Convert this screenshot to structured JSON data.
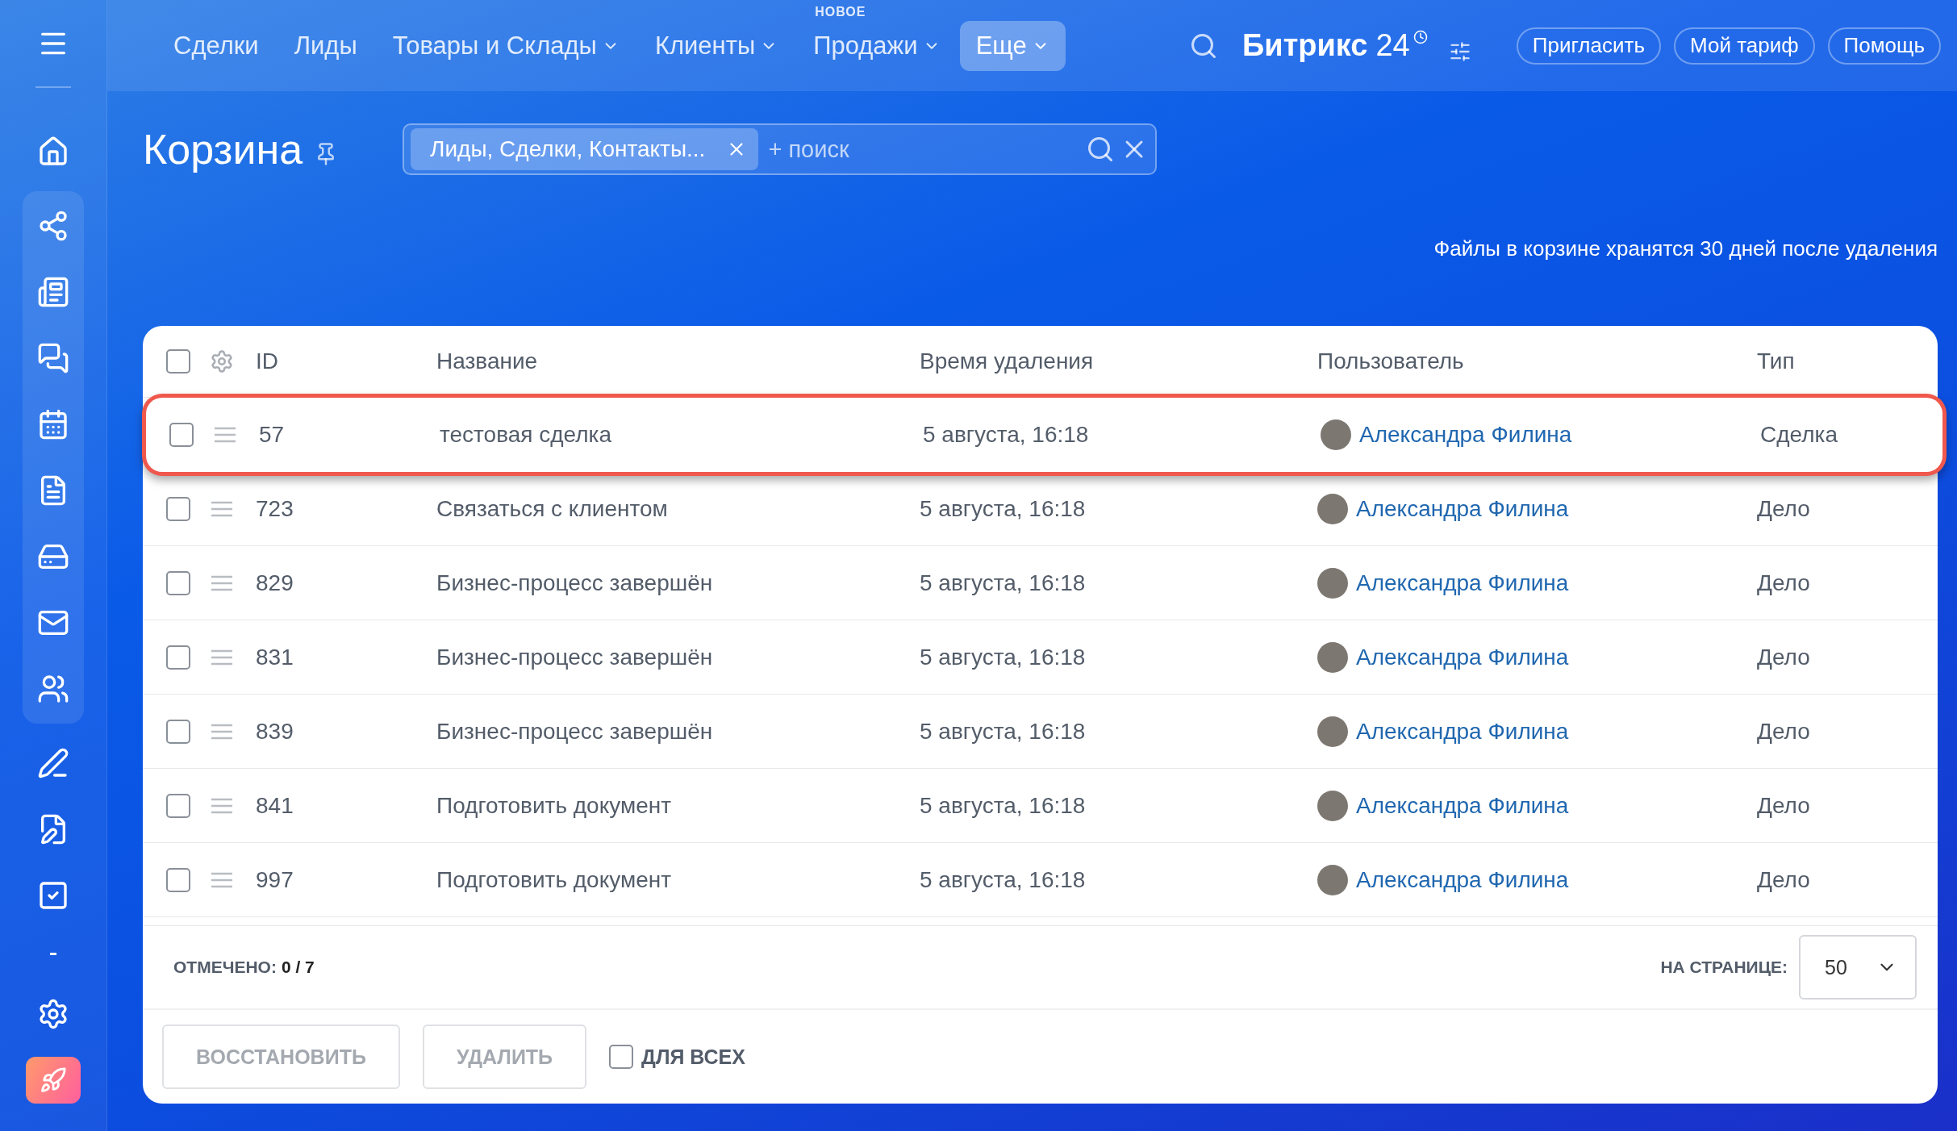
{
  "topbar": {
    "nav": [
      {
        "label": "Сделки",
        "dropdown": false,
        "selected": false
      },
      {
        "label": "Лиды",
        "dropdown": false,
        "selected": false
      },
      {
        "label": "Товары и Склады",
        "dropdown": true,
        "selected": false
      },
      {
        "label": "Клиенты",
        "dropdown": true,
        "selected": false
      },
      {
        "label": "Продажи",
        "dropdown": true,
        "selected": false,
        "badge": "НОВОЕ"
      },
      {
        "label": "Еще",
        "dropdown": true,
        "selected": true
      }
    ],
    "brand": {
      "name": "Битрикс",
      "number": "24"
    },
    "buttons": [
      "Пригласить",
      "Мой тариф",
      "Помощь"
    ]
  },
  "page": {
    "title": "Корзина",
    "filter": {
      "chip": "Лиды, Сделки, Контакты...",
      "placeholder": "+ поиск"
    },
    "note": "Файлы в корзине хранятся 30 дней после удаления"
  },
  "table": {
    "columns": [
      "ID",
      "Название",
      "Время удаления",
      "Пользователь",
      "Тип"
    ],
    "all_checked": false,
    "rows": [
      {
        "id": "57",
        "name": "тестовая сделка",
        "time": "5 августа, 16:18",
        "user": "Александра Филина",
        "type": "Сделка",
        "checked": false,
        "highlighted": true
      },
      {
        "id": "723",
        "name": "Связаться с клиентом",
        "time": "5 августа, 16:18",
        "user": "Александра Филина",
        "type": "Дело",
        "checked": false,
        "highlighted": false
      },
      {
        "id": "829",
        "name": "Бизнес-процесс завершён",
        "time": "5 августа, 16:18",
        "user": "Александра Филина",
        "type": "Дело",
        "checked": false,
        "highlighted": false
      },
      {
        "id": "831",
        "name": "Бизнес-процесс завершён",
        "time": "5 августа, 16:18",
        "user": "Александра Филина",
        "type": "Дело",
        "checked": false,
        "highlighted": false
      },
      {
        "id": "839",
        "name": "Бизнес-процесс завершён",
        "time": "5 августа, 16:18",
        "user": "Александра Филина",
        "type": "Дело",
        "checked": false,
        "highlighted": false
      },
      {
        "id": "841",
        "name": "Подготовить документ",
        "time": "5 августа, 16:18",
        "user": "Александра Филина",
        "type": "Дело",
        "checked": false,
        "highlighted": false
      },
      {
        "id": "997",
        "name": "Подготовить документ",
        "time": "5 августа, 16:18",
        "user": "Александра Филина",
        "type": "Дело",
        "checked": false,
        "highlighted": false
      }
    ]
  },
  "footer": {
    "selected_label": "ОТМЕЧЕНО:",
    "selected_count": "0 / 7",
    "per_page_label": "НА СТРАНИЦЕ:",
    "per_page": "50",
    "buttons": [
      {
        "label": "ВОССТАНОВИТЬ",
        "disabled": true
      },
      {
        "label": "УДАЛИТЬ",
        "disabled": true
      }
    ],
    "for_all": {
      "label": "ДЛЯ ВСЕХ",
      "checked": false
    }
  }
}
